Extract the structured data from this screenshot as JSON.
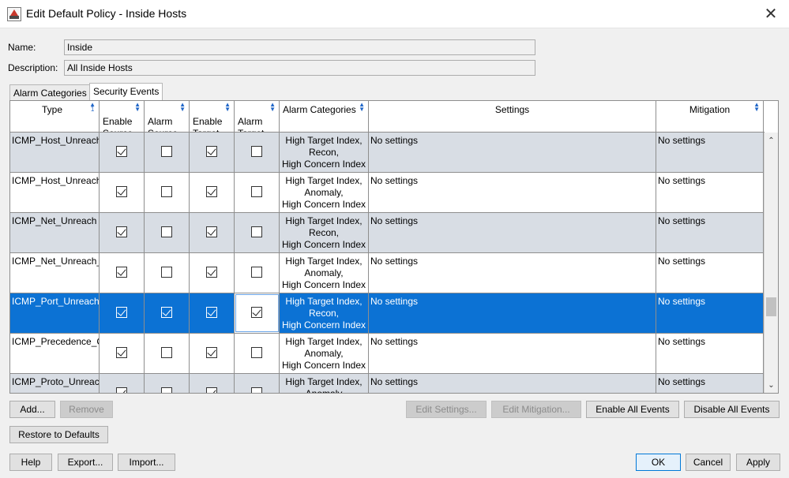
{
  "window": {
    "title": "Edit Default Policy - Inside Hosts"
  },
  "form": {
    "name_label": "Name:",
    "name_value": "Inside",
    "description_label": "Description:",
    "description_value": "All Inside Hosts"
  },
  "tabs": [
    {
      "label": "Alarm Categories"
    },
    {
      "label": "Security Events"
    }
  ],
  "table": {
    "headers": {
      "type": "Type",
      "enable1": "Enable\nSource",
      "alarm_source": "Alarm\nSource",
      "enable2": "Enable\nTarget",
      "alarm_target": "Alarm\nTarget",
      "alarm_categories": "Alarm Categories",
      "settings": "Settings",
      "mitigation": "Mitigation"
    },
    "rows": [
      {
        "type": "ICMP_Host_Unreach",
        "enable_source": true,
        "alarm_source": false,
        "enable_target": true,
        "alarm_target": false,
        "categories": "High Target Index, Recon, High Concern Index",
        "settings": "No settings",
        "mitigation": "No settings"
      },
      {
        "type": "ICMP_Host_Unreach",
        "enable_source": true,
        "alarm_source": false,
        "enable_target": true,
        "alarm_target": false,
        "categories": "High Target Index, Anomaly, High Concern Index",
        "settings": "No settings",
        "mitigation": "No settings"
      },
      {
        "type": "ICMP_Net_Unreach",
        "enable_source": true,
        "alarm_source": false,
        "enable_target": true,
        "alarm_target": false,
        "categories": "High Target Index, Recon, High Concern Index",
        "settings": "No settings",
        "mitigation": "No settings"
      },
      {
        "type": "ICMP_Net_Unreach_",
        "enable_source": true,
        "alarm_source": false,
        "enable_target": true,
        "alarm_target": false,
        "categories": "High Target Index, Anomaly, High Concern Index",
        "settings": "No settings",
        "mitigation": "No settings"
      },
      {
        "type": "ICMP_Port_Unreach",
        "enable_source": true,
        "alarm_source": true,
        "enable_target": true,
        "alarm_target": true,
        "categories": "High Target Index, Recon, High Concern Index",
        "settings": "No settings",
        "mitigation": "No settings",
        "selected": true
      },
      {
        "type": "ICMP_Precedence_C",
        "enable_source": true,
        "alarm_source": false,
        "enable_target": true,
        "alarm_target": false,
        "categories": "High Target Index, Anomaly, High Concern Index",
        "settings": "No settings",
        "mitigation": "No settings"
      },
      {
        "type": "ICMP_Proto_Unreacl",
        "enable_source": true,
        "alarm_source": false,
        "enable_target": true,
        "alarm_target": false,
        "categories": "High Target Index, Anomaly",
        "settings": "No settings",
        "mitigation": "No settings"
      }
    ]
  },
  "buttons": {
    "add": "Add...",
    "remove": "Remove",
    "edit_settings": "Edit Settings...",
    "edit_mitigation": "Edit Mitigation...",
    "enable_all": "Enable All Events",
    "disable_all": "Disable All Events",
    "restore_defaults": "Restore to Defaults",
    "help": "Help",
    "export": "Export...",
    "import": "Import...",
    "ok": "OK",
    "cancel": "Cancel",
    "apply": "Apply"
  },
  "icons": {
    "close": "close-icon",
    "sort": "sort-arrows-icon",
    "scroll_up": "chevron-up-icon",
    "scroll_down": "chevron-down-icon"
  }
}
